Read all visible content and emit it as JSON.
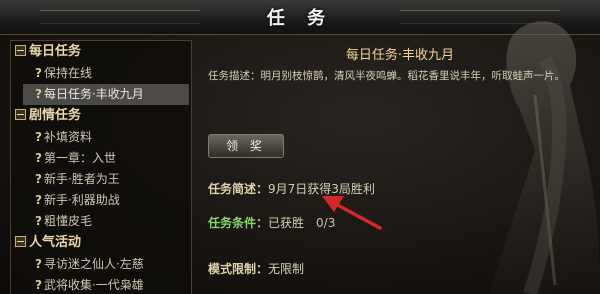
{
  "window": {
    "title": "任 务"
  },
  "sidebar": {
    "sections": [
      {
        "label": "每日任务",
        "items": [
          {
            "label": "保持在线",
            "selected": false
          },
          {
            "label": "每日任务·丰收九月",
            "selected": true
          }
        ]
      },
      {
        "label": "剧情任务",
        "items": [
          {
            "label": "补填资料"
          },
          {
            "label": "第一章：入世"
          },
          {
            "label": "新手·胜者为王"
          },
          {
            "label": "新手·利器助战"
          },
          {
            "label": "粗懂皮毛"
          }
        ]
      },
      {
        "label": "人气活动",
        "items": [
          {
            "label": "寻访迷之仙人·左慈"
          },
          {
            "label": "武将收集·一代枭雄"
          }
        ]
      }
    ]
  },
  "quest": {
    "title": "每日任务·丰收九月",
    "description": "任务描述：明月别枝惊鹊，清风半夜鸣蝉。稻花香里说丰年，听取蛙声一片。",
    "reward_button": "领 奖",
    "summary_label": "任务简述：",
    "summary_value": "9月7日获得3局胜利",
    "condition_label": "任务条件：",
    "condition_value": "已获胜",
    "condition_count": "0/3",
    "mode_label": "模式限制：",
    "mode_value": "无限制"
  },
  "colors": {
    "arrow": "#d8262a",
    "accent": "#86d46b"
  },
  "icons": {
    "section_toggle": "minus-box-icon",
    "item_marker": "question-mark-icon",
    "close": "close-icon"
  }
}
